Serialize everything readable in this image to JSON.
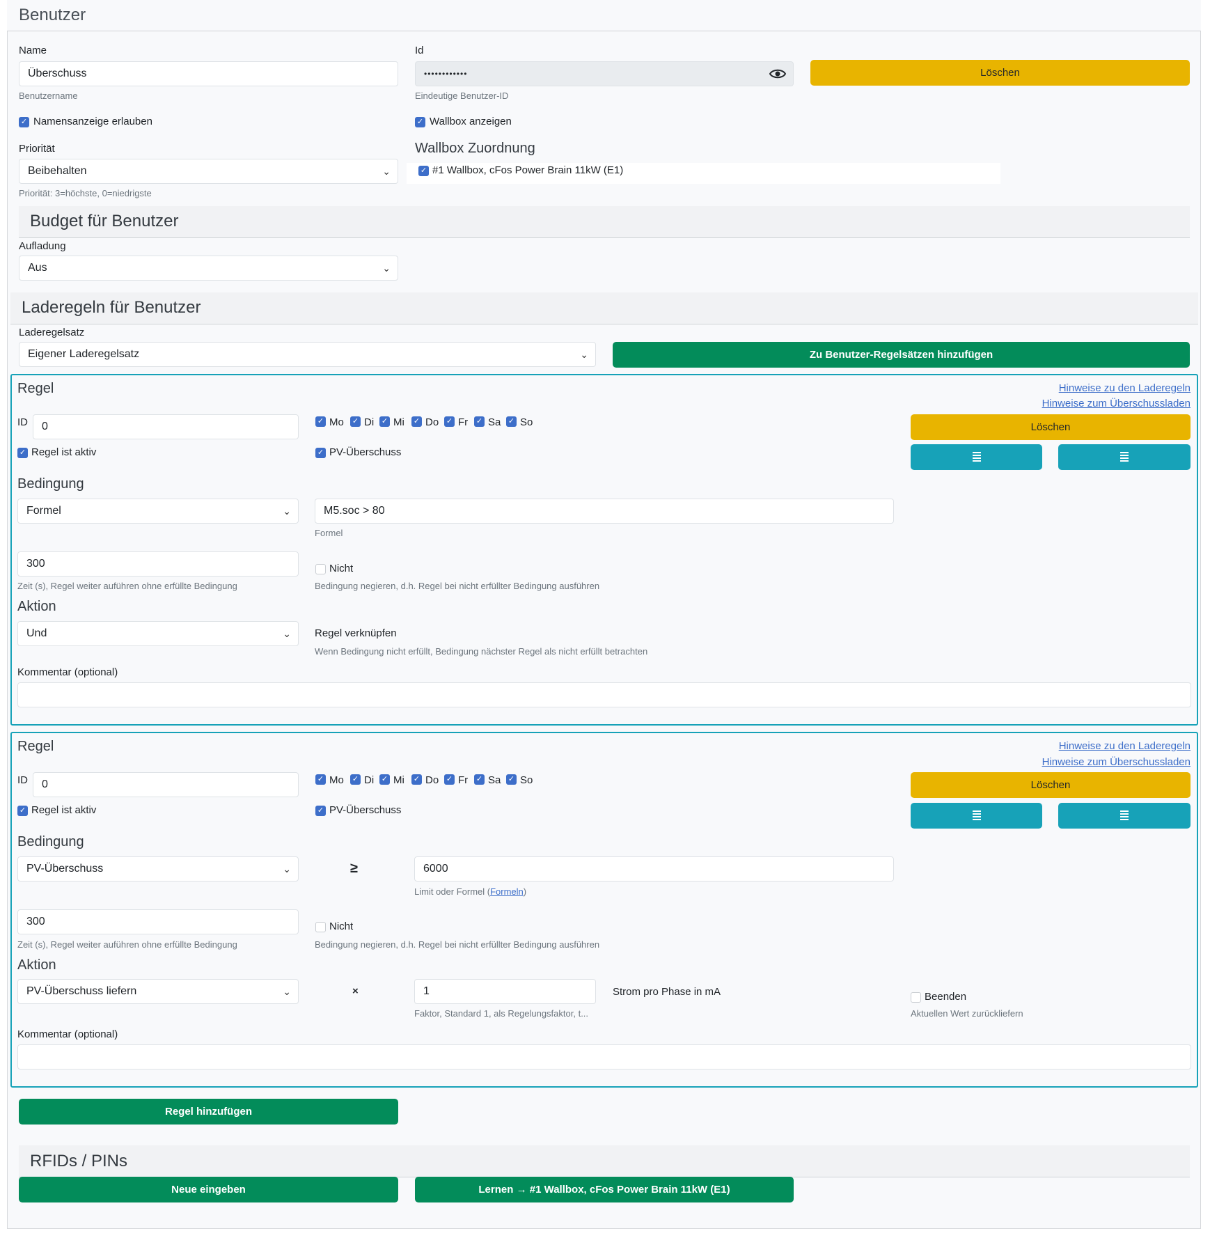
{
  "header": {
    "title": "Benutzer"
  },
  "user": {
    "name_label": "Name",
    "name_value": "Überschuss",
    "name_hint": "Benutzername",
    "id_label": "Id",
    "id_value": "••••••••••••",
    "id_hint": "Eindeutige Benutzer-ID",
    "delete_label": "Löschen",
    "allow_name_label": "Namensanzeige erlauben",
    "show_wallbox_label": "Wallbox anzeigen",
    "priority_label": "Priorität",
    "priority_value": "Beibehalten",
    "priority_hint": "Priorität: 3=höchste, 0=niedrigste",
    "wallbox_assign_title": "Wallbox Zuordnung",
    "wallbox_item": "#1 Wallbox, cFos Power Brain 11kW (E1)"
  },
  "budget": {
    "title": "Budget für Benutzer",
    "charge_label": "Aufladung",
    "charge_value": "Aus"
  },
  "rules_section": {
    "title": "Laderegeln für Benutzer",
    "ruleset_label": "Laderegelsatz",
    "ruleset_value": "Eigener Laderegelsatz",
    "add_to_user_sets": "Zu Benutzer-Regelsätzen hinzufügen"
  },
  "rules": [
    {
      "title": "Regel",
      "link1": "Hinweise zu den Laderegeln",
      "link2": "Hinweise zum Überschussladen",
      "id_label": "ID",
      "id_value": "0",
      "days": [
        "Mo",
        "Di",
        "Mi",
        "Do",
        "Fr",
        "Sa",
        "So"
      ],
      "delete_label": "Löschen",
      "active_label": "Regel ist aktiv",
      "pv_label": "PV-Überschuss",
      "condition_title": "Bedingung",
      "condition_type": "Formel",
      "formula_value": "M5.soc > 80",
      "formula_hint": "Formel",
      "time_value": "300",
      "time_hint": "Zeit (s), Regel weiter auführen ohne erfüllte Bedingung",
      "not_label": "Nicht",
      "not_hint": "Bedingung negieren, d.h. Regel bei nicht erfüllter Bedingung ausführen",
      "action_title": "Aktion",
      "action_value": "Und",
      "link_rule_label": "Regel verknüpfen",
      "link_rule_hint": "Wenn Bedingung nicht erfüllt, Bedingung nächster Regel als nicht erfüllt betrachten",
      "comment_label": "Kommentar (optional)",
      "comment_value": ""
    },
    {
      "title": "Regel",
      "link1": "Hinweise zu den Laderegeln",
      "link2": "Hinweise zum Überschussladen",
      "id_label": "ID",
      "id_value": "0",
      "days": [
        "Mo",
        "Di",
        "Mi",
        "Do",
        "Fr",
        "Sa",
        "So"
      ],
      "delete_label": "Löschen",
      "active_label": "Regel ist aktiv",
      "pv_label": "PV-Überschuss",
      "condition_title": "Bedingung",
      "condition_type": "PV-Überschuss",
      "operator": "≥",
      "limit_value": "6000",
      "limit_hint": "Limit oder Formel (",
      "limit_hint_link": "Formeln",
      "limit_hint_end": ")",
      "time_value": "300",
      "time_hint": "Zeit (s), Regel weiter auführen ohne erfüllte Bedingung",
      "not_label": "Nicht",
      "not_hint": "Bedingung negieren, d.h. Regel bei nicht erfüllter Bedingung ausführen",
      "action_title": "Aktion",
      "action_value": "PV-Überschuss liefern",
      "multiply": "×",
      "factor_value": "1",
      "factor_hint": "Faktor, Standard 1, als Regelungsfaktor, t...",
      "unit_label": "Strom pro Phase in mA",
      "stop_label": "Beenden",
      "stop_hint": "Aktuellen Wert zurückliefern",
      "comment_label": "Kommentar (optional)",
      "comment_value": ""
    }
  ],
  "add_rule_label": "Regel hinzufügen",
  "rfid": {
    "title": "RFIDs / PINs",
    "new_label": "Neue eingeben",
    "learn_label": "Lernen → #1 Wallbox, cFos Power Brain 11kW (E1)"
  },
  "icons": {
    "eye": "eye-icon",
    "chevron": "chevron-down-icon",
    "check": "check-icon",
    "arrange": "arrange-icon"
  }
}
